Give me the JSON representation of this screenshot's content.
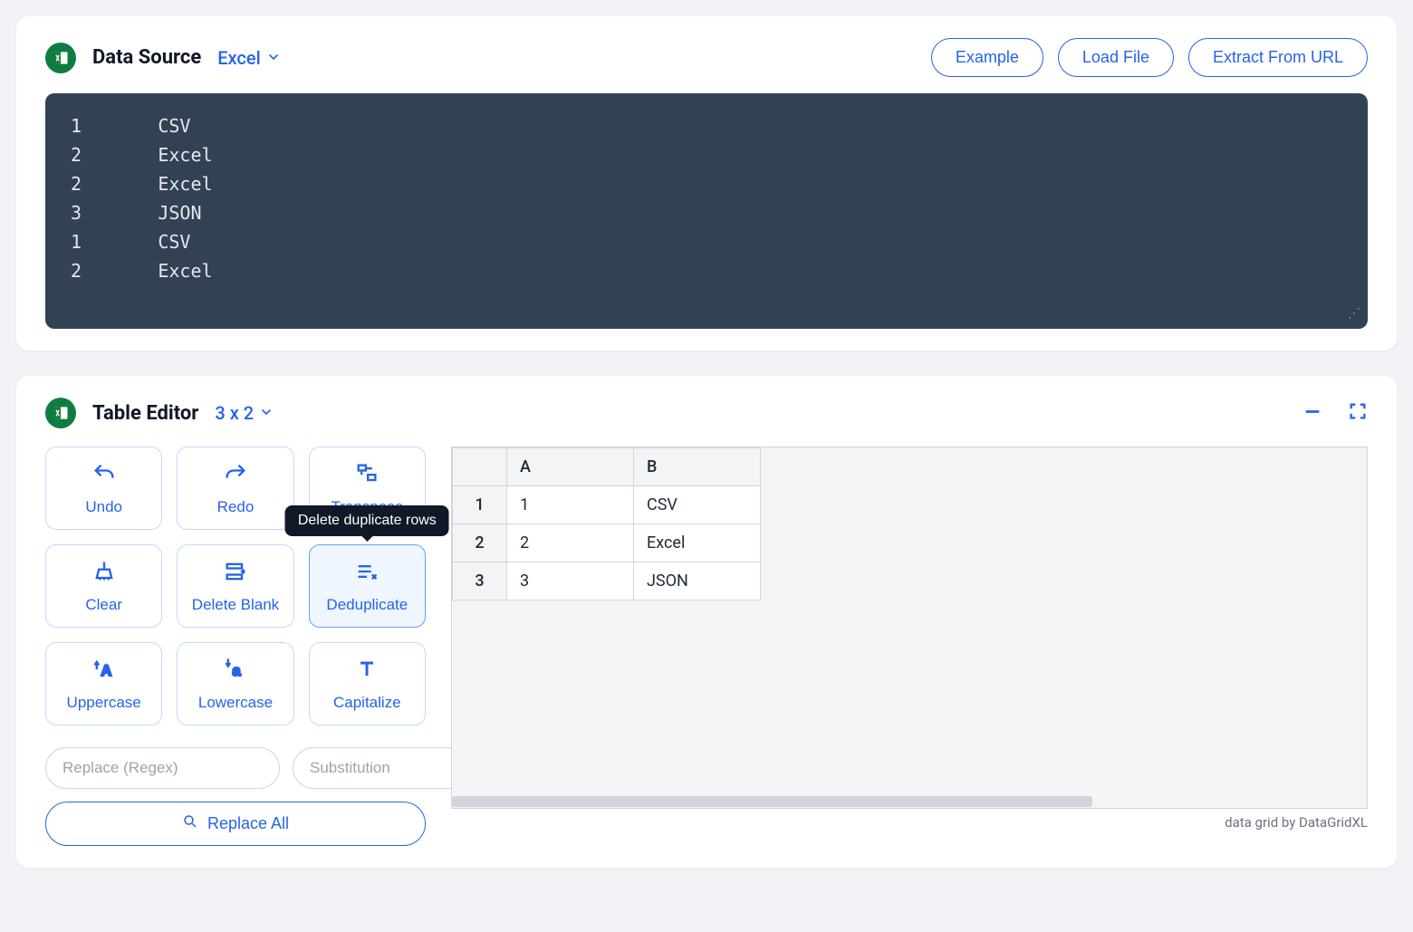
{
  "colors": {
    "accent": "#2563eb",
    "excel": "#107c41"
  },
  "source": {
    "title": "Data Source",
    "type_label": "Excel",
    "buttons": {
      "example": "Example",
      "load_file": "Load File",
      "extract_url": "Extract From URL"
    },
    "code_lines": [
      {
        "a": "1",
        "b": "CSV"
      },
      {
        "a": "2",
        "b": "Excel"
      },
      {
        "a": "2",
        "b": "Excel"
      },
      {
        "a": "3",
        "b": "JSON"
      },
      {
        "a": "1",
        "b": "CSV"
      },
      {
        "a": "2",
        "b": "Excel"
      }
    ]
  },
  "editor": {
    "title": "Table Editor",
    "dims": "3 x 2",
    "tooltip": "Delete duplicate rows",
    "tools": {
      "undo": "Undo",
      "redo": "Redo",
      "transpose": "Transpose",
      "clear": "Clear",
      "delete_blank": "Delete Blank",
      "deduplicate": "Deduplicate",
      "uppercase": "Uppercase",
      "lowercase": "Lowercase",
      "capitalize": "Capitalize"
    },
    "replace": {
      "regex_placeholder": "Replace (Regex)",
      "sub_placeholder": "Substitution",
      "button": "Replace All"
    },
    "grid": {
      "columns": [
        "A",
        "B"
      ],
      "rows": [
        {
          "n": "1",
          "cells": [
            "1",
            "CSV"
          ]
        },
        {
          "n": "2",
          "cells": [
            "2",
            "Excel"
          ]
        },
        {
          "n": "3",
          "cells": [
            "3",
            "JSON"
          ]
        }
      ]
    },
    "credit": "data grid by DataGridXL"
  }
}
